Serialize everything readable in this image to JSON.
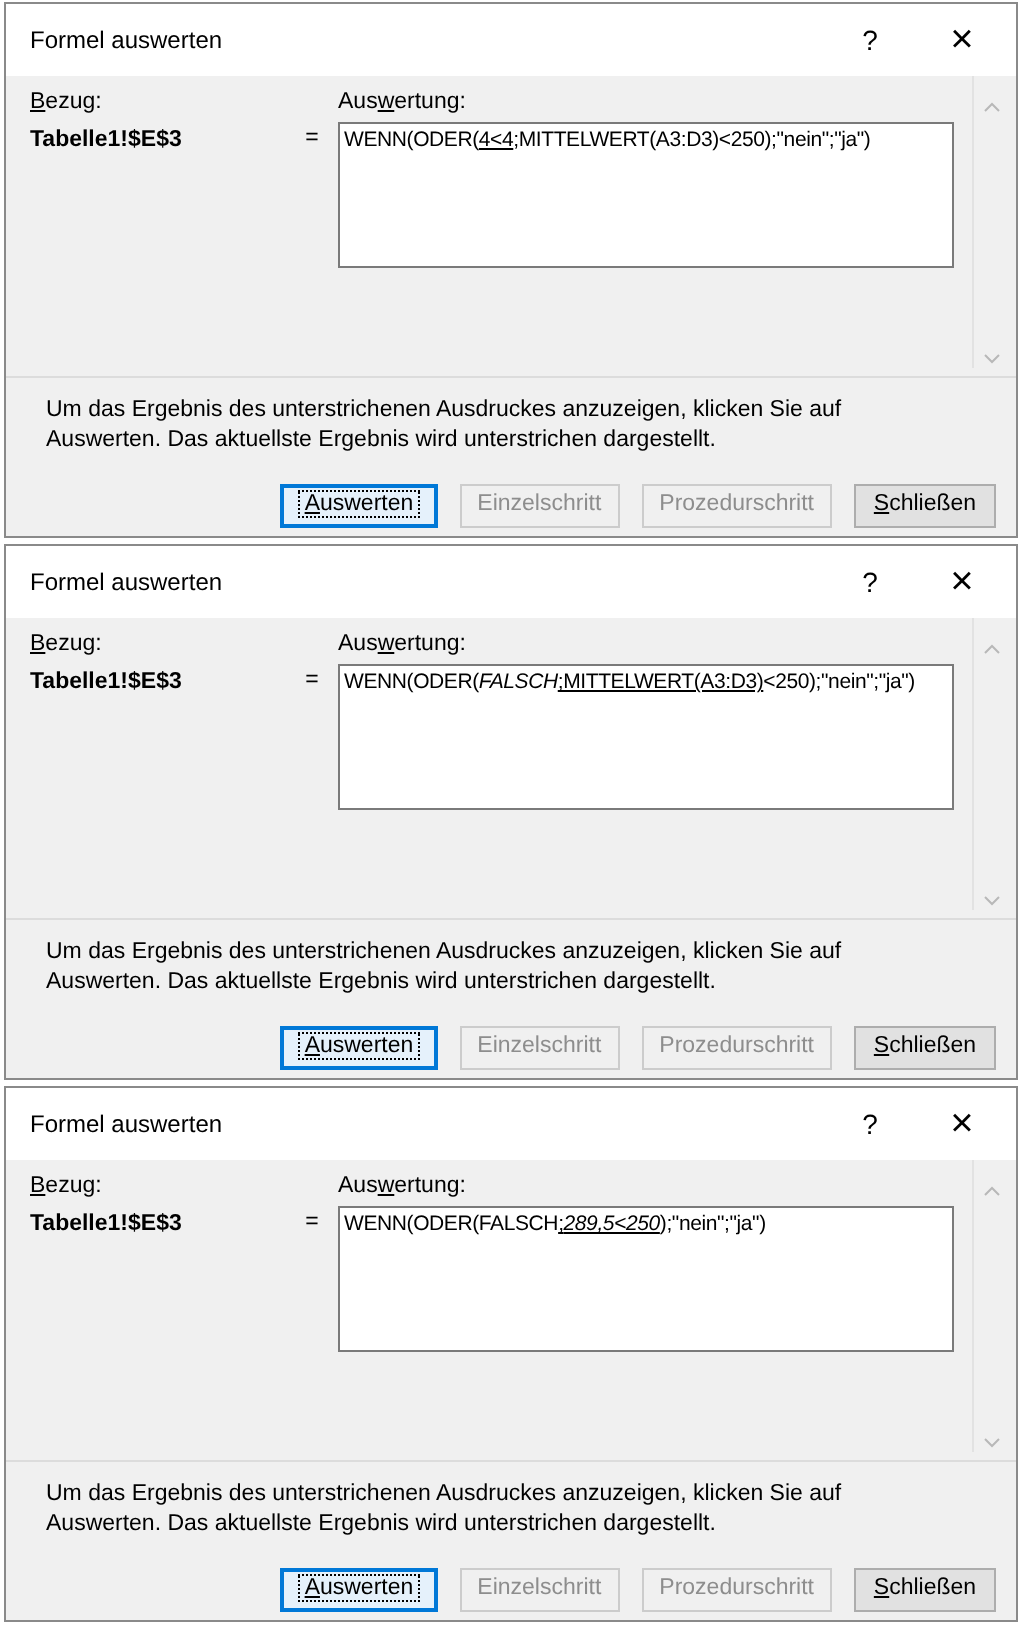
{
  "dialogs": [
    {
      "title": "Formel auswerten",
      "help": "?",
      "close": "×",
      "reference_label": {
        "key": "B",
        "after": "ezug:"
      },
      "reference": "Tabelle1!$E$3",
      "equals": "=",
      "evaluation_label": {
        "before": "Aus",
        "key": "w",
        "after": "ertung:"
      },
      "formula": [
        {
          "text": "WENN(ODER(",
          "underlined": false,
          "italic": false
        },
        {
          "text": "4<4",
          "underlined": true,
          "italic": false
        },
        {
          "text": ";MITTELWERT(A3:D3)<250);\"nein\";\"ja\")",
          "underlined": false,
          "italic": false
        }
      ],
      "hint": "Um das Ergebnis des unterstrichenen Ausdruckes anzuzeigen, klicken Sie auf Auswerten. Das aktuellste Ergebnis wird unterstrichen dargestellt.",
      "buttons": [
        {
          "label": {
            "key": "A",
            "after": "uswerten"
          },
          "default": true,
          "disabled": false
        },
        {
          "label": {
            "before": "Einzelschritt"
          },
          "default": false,
          "disabled": true
        },
        {
          "label": {
            "before": "Prozedurschritt"
          },
          "default": false,
          "disabled": true
        },
        {
          "label": {
            "key": "S",
            "after": "chließen"
          },
          "default": false,
          "disabled": false
        }
      ]
    },
    {
      "title": "Formel auswerten",
      "help": "?",
      "close": "×",
      "reference_label": {
        "key": "B",
        "after": "ezug:"
      },
      "reference": "Tabelle1!$E$3",
      "equals": "=",
      "evaluation_label": {
        "before": "Aus",
        "key": "w",
        "after": "ertung:"
      },
      "formula": [
        {
          "text": "WENN(ODER(",
          "underlined": false,
          "italic": false
        },
        {
          "text": "FALSCH",
          "underlined": false,
          "italic": true
        },
        {
          "text": ";MITTELWERT(A3:D3)",
          "underlined": true,
          "italic": false
        },
        {
          "text": "<250);\"nein\";\"ja\")",
          "underlined": false,
          "italic": false
        }
      ],
      "hint": "Um das Ergebnis des unterstrichenen Ausdruckes anzuzeigen, klicken Sie auf Auswerten. Das aktuellste Ergebnis wird unterstrichen dargestellt.",
      "buttons": [
        {
          "label": {
            "key": "A",
            "after": "uswerten"
          },
          "default": true,
          "disabled": false
        },
        {
          "label": {
            "before": "Einzelschritt"
          },
          "default": false,
          "disabled": true
        },
        {
          "label": {
            "before": "Prozedurschritt"
          },
          "default": false,
          "disabled": true
        },
        {
          "label": {
            "key": "S",
            "after": "chließen"
          },
          "default": false,
          "disabled": false
        }
      ]
    },
    {
      "title": "Formel auswerten",
      "help": "?",
      "close": "×",
      "reference_label": {
        "key": "B",
        "after": "ezug:"
      },
      "reference": "Tabelle1!$E$3",
      "equals": "=",
      "evaluation_label": {
        "before": "Aus",
        "key": "w",
        "after": "ertung:"
      },
      "formula": [
        {
          "text": "WENN(ODER(FALSCH",
          "underlined": false,
          "italic": false
        },
        {
          "text": ";",
          "underlined": true,
          "italic": false
        },
        {
          "text": "289,5<250",
          "underlined": true,
          "italic": true
        },
        {
          "text": ");\"nein\";\"ja\")",
          "underlined": false,
          "italic": false
        }
      ],
      "hint": "Um das Ergebnis des unterstrichenen Ausdruckes anzuzeigen, klicken Sie auf Auswerten. Das aktuellste Ergebnis wird unterstrichen dargestellt.",
      "buttons": [
        {
          "label": {
            "key": "A",
            "after": "uswerten"
          },
          "default": true,
          "disabled": false
        },
        {
          "label": {
            "before": "Einzelschritt"
          },
          "default": false,
          "disabled": true
        },
        {
          "label": {
            "before": "Prozedurschritt"
          },
          "default": false,
          "disabled": true
        },
        {
          "label": {
            "key": "S",
            "after": "chließen"
          },
          "default": false,
          "disabled": false
        }
      ]
    }
  ]
}
